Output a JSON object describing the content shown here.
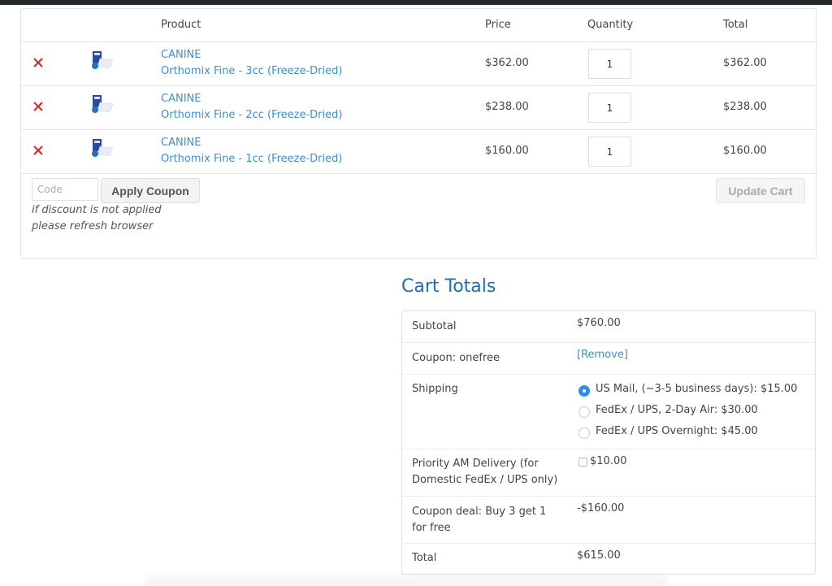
{
  "cart": {
    "headers": {
      "product": "Product",
      "price": "Price",
      "quantity": "Quantity",
      "total": "Total"
    },
    "items": [
      {
        "category": "CANINE",
        "name": "Orthomix Fine - 3cc (Freeze-Dried)",
        "price": "$362.00",
        "quantity": "1",
        "total": "$362.00"
      },
      {
        "category": "CANINE",
        "name": "Orthomix Fine - 2cc (Freeze-Dried)",
        "price": "$238.00",
        "quantity": "1",
        "total": "$238.00"
      },
      {
        "category": "CANINE",
        "name": "Orthomix Fine - 1cc (Freeze-Dried)",
        "price": "$160.00",
        "quantity": "1",
        "total": "$160.00"
      }
    ],
    "coupon_placeholder": "Code",
    "apply_coupon_label": "Apply Coupon",
    "note_line1": "if discount is not applied",
    "note_line2": "please refresh browser",
    "update_cart_label": "Update Cart"
  },
  "totals": {
    "title": "Cart Totals",
    "subtotal_label": "Subtotal",
    "subtotal_value": "$760.00",
    "coupon_label": "Coupon: onefree",
    "coupon_remove": "[Remove]",
    "shipping_label": "Shipping",
    "shipping_options": [
      {
        "label": "US Mail, (~3-5 business days): $15.00",
        "selected": true
      },
      {
        "label": "FedEx / UPS, 2-Day Air: $30.00",
        "selected": false
      },
      {
        "label": "FedEx / UPS Overnight: $45.00",
        "selected": false
      }
    ],
    "priority_label_line1": "Priority AM Delivery (for",
    "priority_label_line2": "Domestic FedEx / UPS only)",
    "priority_value": "$10.00",
    "priority_checked": false,
    "deal_label_line1": "Coupon deal: Buy 3 get 1",
    "deal_label_line2": "for free",
    "deal_value": "-$160.00",
    "total_label": "Total",
    "total_value": "$615.00"
  },
  "colors": {
    "link": "#3a8fd0",
    "heading": "#1c6fb3",
    "remove": "#e02020",
    "radio_selected": "#2f8cf0"
  }
}
